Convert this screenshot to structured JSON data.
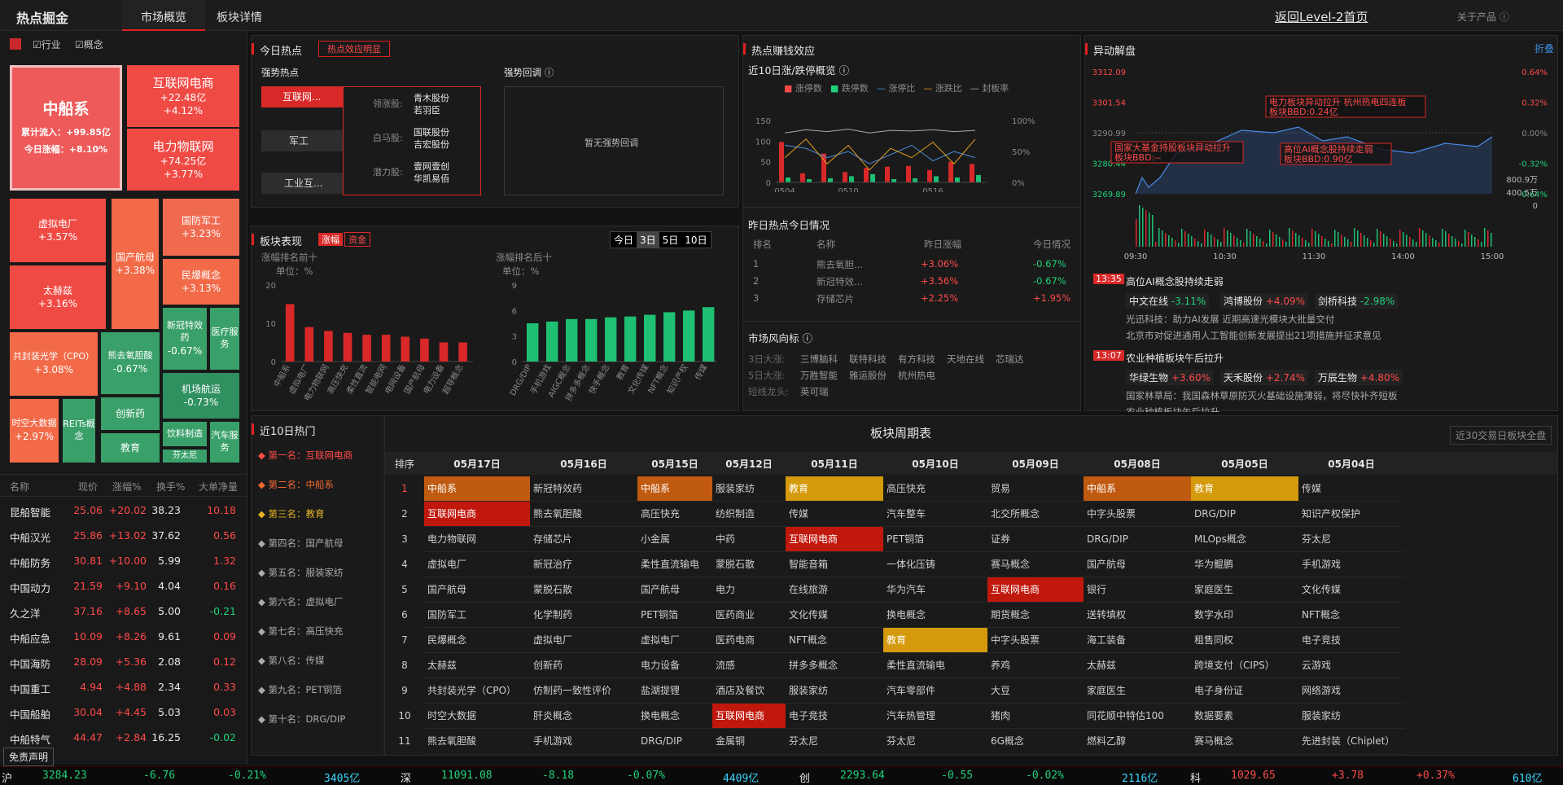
{
  "topbar": {
    "brand": "热点掘金",
    "tabs": [
      "市场概览",
      "板块详情"
    ],
    "active_tab": "市场概览",
    "back_link": "返回Level-2首页",
    "about": "关于产品"
  },
  "treemap": {
    "filters": [
      {
        "label": "行业",
        "checked": true
      },
      {
        "label": "概念",
        "checked": true
      }
    ],
    "big": {
      "name": "中船系",
      "inflow_label": "累计流入：",
      "inflow": "+99.85亿",
      "change_label": "今日涨幅：",
      "change": "+8.10%"
    },
    "tiles": [
      {
        "name": "互联网电商",
        "l2": "+22.48亿",
        "l3": "+4.12%"
      },
      {
        "name": "电力物联网",
        "l2": "+74.25亿",
        "l3": "+3.77%"
      },
      {
        "name": "虚拟电厂",
        "l2": "+3.57%"
      },
      {
        "name": "国产航母",
        "l2": "+3.38%"
      },
      {
        "name": "国防军工",
        "l2": "+3.23%"
      },
      {
        "name": "太赫兹",
        "l2": "+3.16%"
      },
      {
        "name": "民爆概念",
        "l2": "+3.13%"
      },
      {
        "name": "新冠特效药",
        "l2": "-0.67%"
      },
      {
        "name": "医疗服务",
        "l2": ""
      },
      {
        "name": "共封装光学（CPO）",
        "l2": "+3.08%"
      },
      {
        "name": "熊去氧胆酸",
        "l2": "-0.67%"
      },
      {
        "name": "机场航运",
        "l2": "-0.73%"
      },
      {
        "name": "时空大数据",
        "l2": "+2.97%"
      },
      {
        "name": "REITs概念",
        "l2": ""
      },
      {
        "name": "创新药",
        "l2": ""
      },
      {
        "name": "饮料制造",
        "l2": ""
      },
      {
        "name": "汽车服务",
        "l2": ""
      },
      {
        "name": "教育",
        "l2": ""
      },
      {
        "name": "芬太尼",
        "l2": ""
      }
    ]
  },
  "stocks": {
    "headers": [
      "名称",
      "现价",
      "涨幅%",
      "换手%",
      "大单净量"
    ],
    "rows": [
      [
        "昆船智能",
        "25.06",
        "+20.02",
        "38.23",
        "10.18"
      ],
      [
        "中船汉光",
        "25.86",
        "+13.02",
        "37.62",
        "0.56"
      ],
      [
        "中船防务",
        "30.81",
        "+10.00",
        "5.99",
        "1.32"
      ],
      [
        "中国动力",
        "21.59",
        "+9.10",
        "4.04",
        "0.16"
      ],
      [
        "久之洋",
        "37.16",
        "+8.65",
        "5.00",
        "-0.21"
      ],
      [
        "中船应急",
        "10.09",
        "+8.26",
        "9.61",
        "0.09"
      ],
      [
        "中国海防",
        "28.09",
        "+5.36",
        "2.08",
        "0.12"
      ],
      [
        "中国重工",
        "4.94",
        "+4.88",
        "2.34",
        "0.33"
      ],
      [
        "中国船舶",
        "30.04",
        "+4.45",
        "5.03",
        "0.03"
      ],
      [
        "中船特气",
        "44.47",
        "+2.84",
        "16.25",
        "-0.02"
      ]
    ],
    "disclaimer": "免责声明"
  },
  "today_hot": {
    "title": "今日热点",
    "tag": "热点效应明显",
    "strong_title": "强势热点",
    "pullback_title": "强势回调",
    "sectors": [
      "互联网...",
      "军工",
      "工业互..."
    ],
    "leaders": [
      {
        "label": "领涨股:",
        "stocks": [
          "青木股份",
          "若羽臣"
        ]
      },
      {
        "label": "白马股:",
        "stocks": [
          "国联股份",
          "吉宏股份"
        ]
      },
      {
        "label": "潜力股:",
        "stocks": [
          "壹网壹创",
          "华凯易佰"
        ]
      }
    ],
    "no_pullback": "暂无强势回调"
  },
  "money_effect": {
    "title": "热点赚钱效应",
    "subtitle": "近10日涨/跌停概览",
    "legend": [
      "涨停数",
      "跌停数",
      "涨停比",
      "涨跌比",
      "封板率"
    ],
    "y_left": [
      "150",
      "100",
      "50",
      "0"
    ],
    "y_right": [
      "100%",
      "50%",
      "0%"
    ],
    "x_ticks": [
      "0504",
      "0510",
      "0516"
    ],
    "yesterday_title": "昨日热点今日情况",
    "yh_headers": [
      "排名",
      "名称",
      "昨日涨幅",
      "今日情况"
    ],
    "yh_rows": [
      [
        "1",
        "熊去氧胆...",
        "+3.06%",
        "-0.67%"
      ],
      [
        "2",
        "新冠特效...",
        "+3.56%",
        "-0.67%"
      ],
      [
        "3",
        "存储芯片",
        "+2.25%",
        "+1.95%"
      ]
    ],
    "wind_title": "市场风向标",
    "wind": [
      {
        "label": "3日大涨:",
        "items": [
          "三博脑科",
          "联特科技",
          "有方科技",
          "天地在线",
          "芯瑞达"
        ]
      },
      {
        "label": "5日大涨:",
        "items": [
          "万胜智能",
          "雅运股份",
          "杭州热电"
        ]
      },
      {
        "label": "短线龙头:",
        "items": [
          "英可瑞"
        ]
      }
    ]
  },
  "chart_data": [
    {
      "type": "bar",
      "title": "近10日涨/跌停概览",
      "x": [
        "0504",
        "",
        "",
        "",
        "",
        "0510",
        "",
        "",
        "",
        "0516"
      ],
      "series": [
        {
          "name": "涨停数",
          "values": [
            98,
            22,
            70,
            25,
            35,
            38,
            40,
            30,
            50,
            45
          ]
        },
        {
          "name": "跌停数",
          "values": [
            12,
            8,
            10,
            15,
            20,
            8,
            10,
            15,
            12,
            18
          ]
        }
      ],
      "ylim": [
        0,
        150
      ]
    },
    {
      "type": "bar",
      "title": "涨幅排名前十",
      "unit": "单位：%",
      "categories": [
        "中船系",
        "虚拟电厂",
        "电力物联网",
        "高压快充",
        "柔性直流",
        "智能电网",
        "电网设备",
        "国产航母",
        "电力设备",
        "超导概念"
      ],
      "values": [
        15,
        9,
        8,
        7.5,
        7,
        7,
        6.5,
        6,
        5,
        5
      ],
      "ylim": [
        0,
        20
      ]
    },
    {
      "type": "bar",
      "title": "涨幅排名后十",
      "unit": "单位：%",
      "categories": [
        "DRG/DIP",
        "手机游戏",
        "AIGC概念",
        "拼多多概念",
        "快手概念",
        "教育",
        "文化传媒",
        "NFT概念",
        "知识产权",
        "传媒"
      ],
      "values": [
        4.5,
        4.7,
        5,
        5,
        5.2,
        5.3,
        5.5,
        5.8,
        6,
        6.4
      ],
      "ylim": [
        0,
        9
      ]
    }
  ],
  "sector_perf": {
    "title": "板块表现",
    "tabs": [
      "涨幅",
      "资金"
    ],
    "periods": [
      "今日",
      "3日",
      "5日",
      "10日"
    ],
    "top_title": "涨幅排名前十",
    "bottom_title": "涨幅排名后十",
    "unit": "单位：%",
    "top_y": [
      "20",
      "10",
      "0"
    ],
    "bot_y": [
      "9",
      "6",
      "3",
      "0"
    ]
  },
  "movers": {
    "title": "异动解盘",
    "fold": "折叠",
    "y_left": [
      "3312.09",
      "3301.54",
      "3290.99",
      "3280.44",
      "3269.89"
    ],
    "y_right": [
      "0.64%",
      "0.32%",
      "0.00%",
      "-0.32%",
      "-0.64%"
    ],
    "vol": [
      "800.9万",
      "400.5万",
      "0"
    ],
    "x": [
      "09:30",
      "10:30",
      "11:30",
      "14:00",
      "15:00"
    ],
    "annotations": [
      "电力板块异动拉升 杭州热电四连板 板块BBD:0.24亿",
      "国家大基金持股板块异动拉升 板块BBD:--",
      "高位AI概念股持续走弱 板块BBD:0.90亿"
    ],
    "news": [
      {
        "time": "13:35",
        "title": "高位AI概念股持续走弱",
        "stocks": [
          [
            "中文在线",
            "-3.11%"
          ],
          [
            "鸿博股份",
            "+4.09%"
          ],
          [
            "剑桥科技",
            "-2.98%"
          ]
        ],
        "items": [
          "光迅科技：助力AI发展 近期高速光模块大批量交付",
          "北京市对促进通用人工智能创新发展提出21项措施并征求意见"
        ]
      },
      {
        "time": "13:07",
        "title": "农业种植板块午后拉升",
        "stocks": [
          [
            "华绿生物",
            "+3.60%"
          ],
          [
            "天禾股份",
            "+2.74%"
          ],
          [
            "万辰生物",
            "+4.80%"
          ]
        ],
        "items": [
          "国家林草局：我国森林草原防灭火基础设施薄弱，将尽快补齐短板",
          "农业种植板块午后拉升"
        ]
      }
    ]
  },
  "hot10": {
    "title": "近10日热门",
    "items": [
      "第一名：互联网电商",
      "第二名：中船系",
      "第三名：教育",
      "第四名：国产航母",
      "第五名：服装家纺",
      "第六名：虚拟电厂",
      "第七名：高压快充",
      "第八名：传媒",
      "第九名：PET铜箔",
      "第十名：DRG/DIP"
    ]
  },
  "cycle": {
    "title": "板块周期表",
    "all_button": "近30交易日板块全盘",
    "rank_header": "排序",
    "dates": [
      "05月17日",
      "05月16日",
      "05月15日",
      "05月12日",
      "05月11日",
      "05月10日",
      "05月09日",
      "05月08日",
      "05月05日",
      "05月04日"
    ],
    "rows": [
      [
        "中船系",
        "新冠特效药",
        "中船系",
        "服装家纺",
        "教育",
        "高压快充",
        "贸易",
        "中船系",
        "教育",
        "传媒"
      ],
      [
        "互联网电商",
        "熊去氧胆酸",
        "高压快充",
        "纺织制造",
        "传媒",
        "汽车整车",
        "北交所概念",
        "中字头股票",
        "DRG/DIP",
        "知识产权保护"
      ],
      [
        "电力物联网",
        "存储芯片",
        "小金属",
        "中药",
        "互联网电商",
        "PET铜箔",
        "证券",
        "DRG/DIP",
        "MLOps概念",
        "芬太尼"
      ],
      [
        "虚拟电厂",
        "新冠治疗",
        "柔性直流输电",
        "蒙脱石散",
        "智能音箱",
        "一体化压铸",
        "赛马概念",
        "国产航母",
        "华为鲲鹏",
        "手机游戏"
      ],
      [
        "国产航母",
        "蒙脱石散",
        "国产航母",
        "电力",
        "在线旅游",
        "华为汽车",
        "互联网电商",
        "银行",
        "家庭医生",
        "文化传媒"
      ],
      [
        "国防军工",
        "化学制药",
        "PET铜箔",
        "医药商业",
        "文化传媒",
        "换电概念",
        "期货概念",
        "送转填权",
        "数字水印",
        "NFT概念"
      ],
      [
        "民爆概念",
        "虚拟电厂",
        "虚拟电厂",
        "医药电商",
        "NFT概念",
        "教育",
        "中字头股票",
        "海工装备",
        "租售同权",
        "电子竞技"
      ],
      [
        "太赫兹",
        "创新药",
        "电力设备",
        "流感",
        "拼多多概念",
        "柔性直流输电",
        "养鸡",
        "太赫兹",
        "跨境支付（CIPS）",
        "云游戏"
      ],
      [
        "共封装光学（CPO）",
        "仿制药一致性评价",
        "盐湖提锂",
        "酒店及餐饮",
        "服装家纺",
        "汽车零部件",
        "大豆",
        "家庭医生",
        "电子身份证",
        "网络游戏"
      ],
      [
        "时空大数据",
        "肝炎概念",
        "换电概念",
        "互联网电商",
        "电子竞技",
        "汽车热管理",
        "猪肉",
        "同花顺中特估100",
        "数据要素",
        "服装家纺"
      ],
      [
        "熊去氧胆酸",
        "手机游戏",
        "DRG/DIP",
        "金属铜",
        "芬太尼",
        "芬太尼",
        "6G概念",
        "燃料乙醇",
        "赛马概念",
        "先进封装（Chiplet）"
      ]
    ],
    "highlights": {
      "0-0": "or",
      "0-2": "or",
      "0-4": "gd",
      "0-7": "or",
      "0-8": "gd",
      "1-0": "rd",
      "2-4": "rd",
      "4-6": "rd",
      "6-5": "gd",
      "9-3": "rd"
    }
  },
  "ticker": [
    {
      "name": "沪",
      "price": "3284.23",
      "chg": "-6.76",
      "pct": "-0.21%",
      "amt": "3405亿"
    },
    {
      "name": "深",
      "price": "11091.08",
      "chg": "-8.18",
      "pct": "-0.07%",
      "amt": "4409亿"
    },
    {
      "name": "创",
      "price": "2293.64",
      "chg": "-0.55",
      "pct": "-0.02%",
      "amt": "2116亿"
    },
    {
      "name": "科",
      "price": "1029.65",
      "chg": "+3.78",
      "pct": "+0.37%",
      "amt": "610亿"
    }
  ]
}
